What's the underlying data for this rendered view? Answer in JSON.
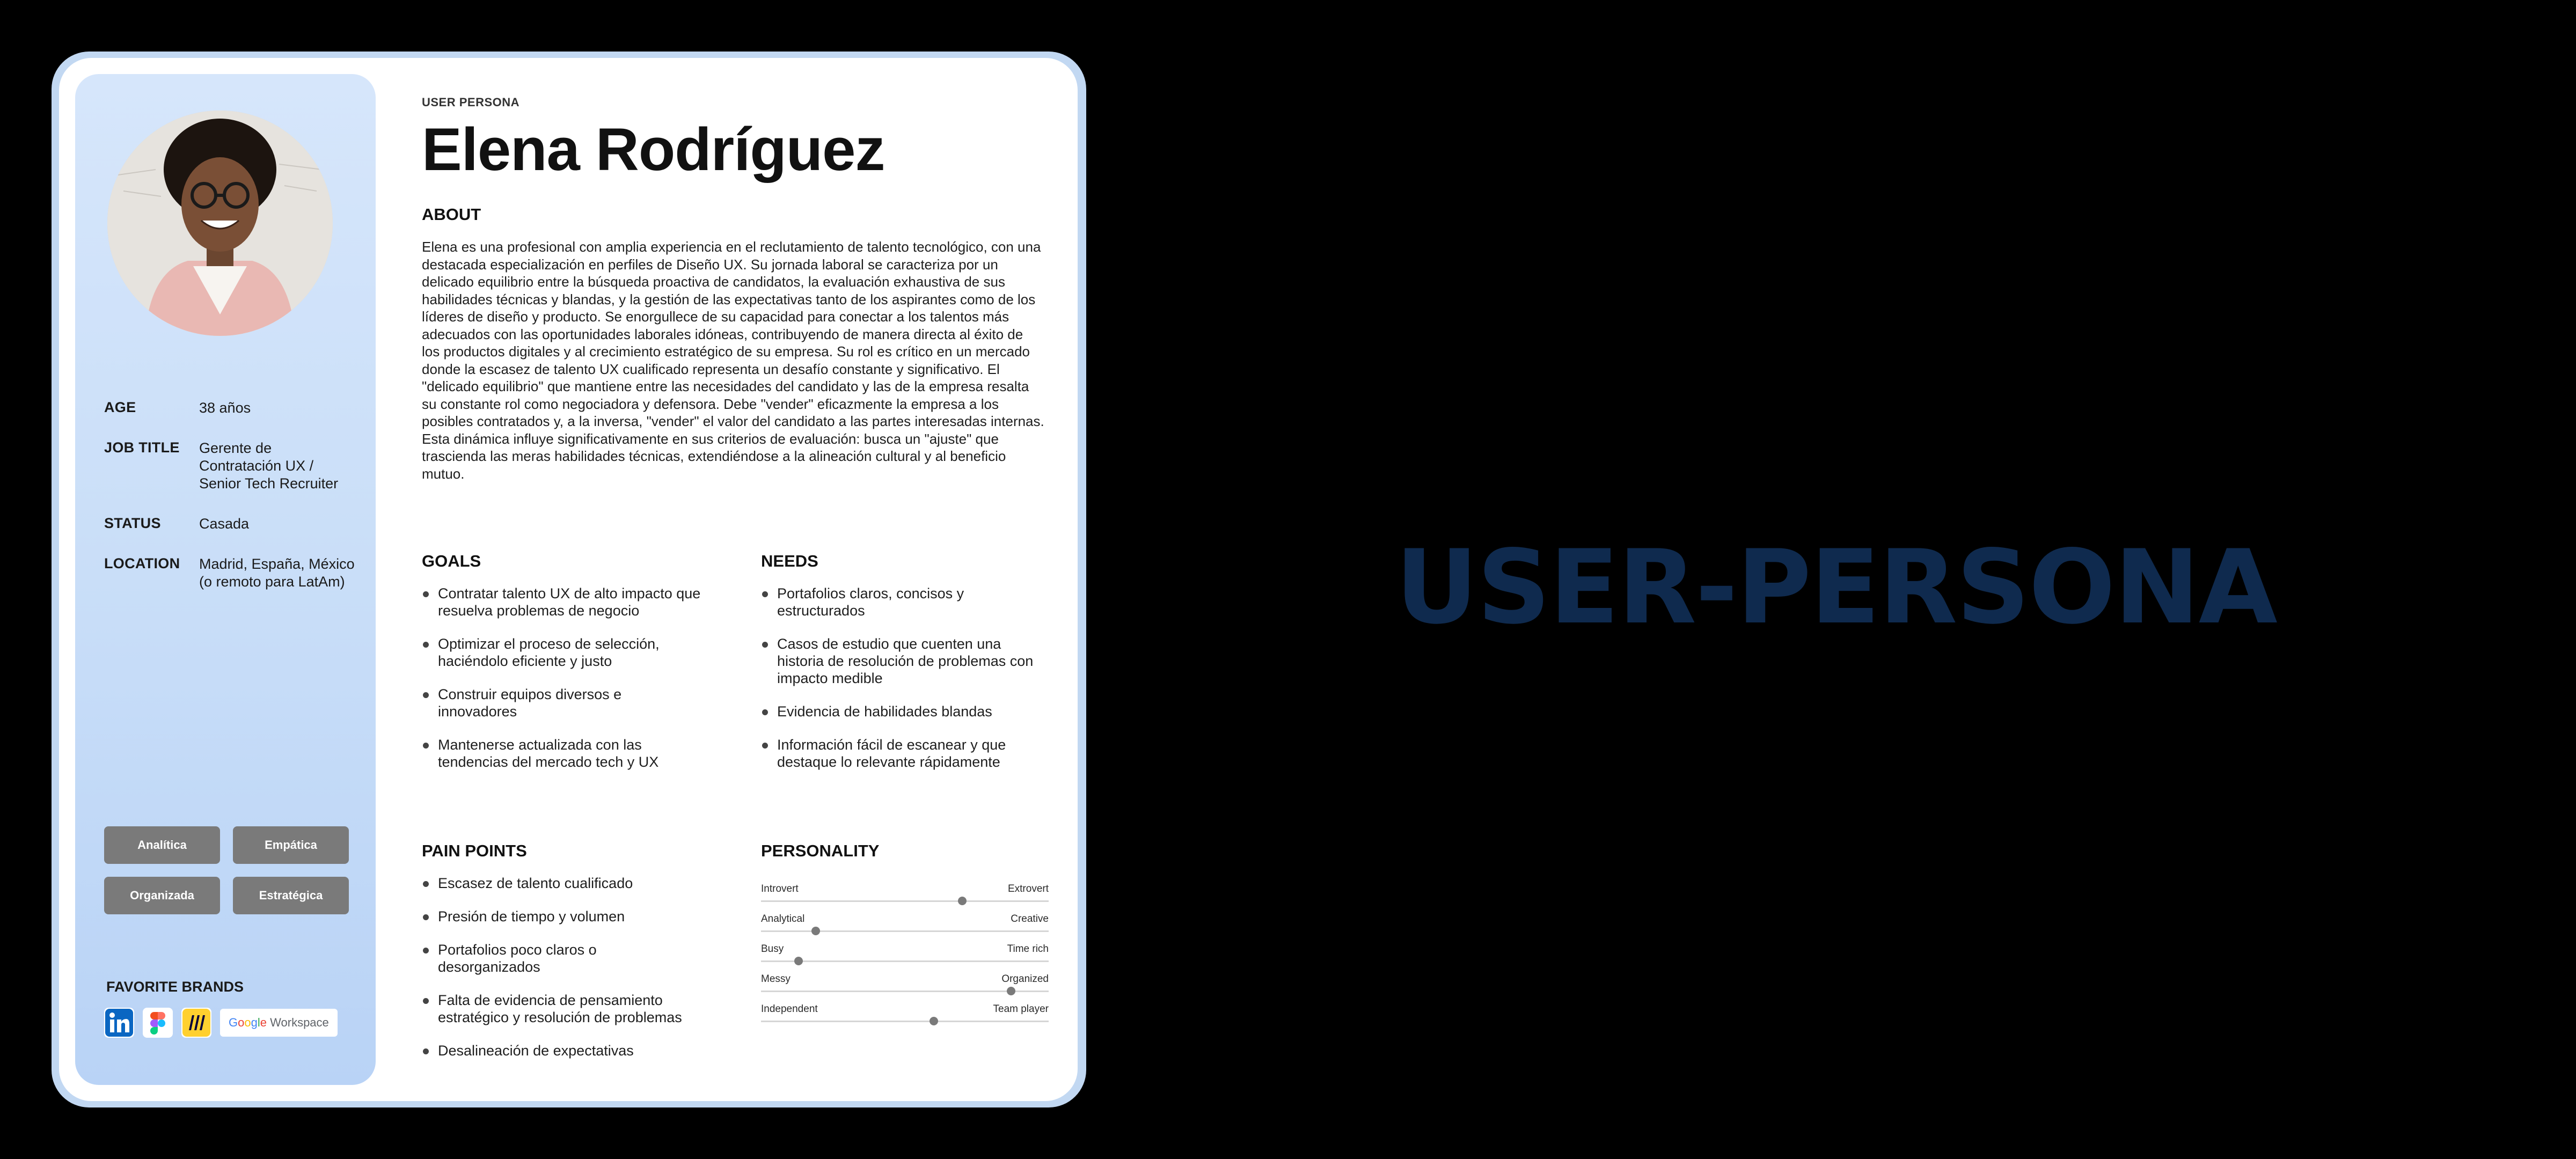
{
  "persona": {
    "eyebrow": "USER PERSONA",
    "name": "Elena Rodríguez",
    "about_title": "ABOUT",
    "about_text": "Elena es una profesional con amplia experiencia en el reclutamiento de talento tecnológico, con una destacada especialización en perfiles de Diseño UX. Su jornada laboral se caracteriza por un delicado equilibrio entre la búsqueda proactiva de candidatos, la evaluación exhaustiva de sus habilidades técnicas y blandas, y la gestión de las expectativas tanto de los aspirantes como de los líderes de diseño y producto. Se enorgullece de su capacidad para conectar a los talentos más adecuados con las oportunidades laborales idóneas, contribuyendo de manera directa al éxito de los productos digitales y al crecimiento estratégico de su empresa. Su rol es crítico en un mercado donde la escasez de talento UX cualificado representa un desafío constante y significativo. El \"delicado equilibrio\" que mantiene entre las necesidades del candidato y las de la empresa resalta su constante rol como negociadora y defensora. Debe \"vender\" eficazmente la empresa a los posibles contratados y, a la inversa, \"vender\" el valor del candidato a las partes interesadas internas. Esta dinámica influye significativamente en sus criterios de evaluación: busca un \"ajuste\" que trascienda las meras habilidades técnicas, extendiéndose a la alineación cultural y al beneficio mutuo."
  },
  "sidebar": {
    "info": [
      {
        "key": "AGE",
        "value": "38 años"
      },
      {
        "key": "JOB TITLE",
        "value": "Gerente de Contratación UX / Senior Tech Recruiter"
      },
      {
        "key": "STATUS",
        "value": "Casada"
      },
      {
        "key": "LOCATION",
        "value": "Madrid, España, México (o remoto para LatAm)"
      }
    ],
    "traits": [
      "Analítica",
      "Empática",
      "Organizada",
      "Estratégica"
    ],
    "brands_title": "FAVORITE BRANDS",
    "brands": [
      "linkedin-icon",
      "figma-icon",
      "miro-icon",
      "google-workspace-logo"
    ],
    "google_workspace_word": "Workspace"
  },
  "goals": {
    "title": "GOALS",
    "items": [
      "Contratar talento UX de alto impacto que resuelva problemas de negocio",
      "Optimizar el proceso de selección, haciéndolo eficiente y justo",
      "Construir equipos diversos e innovadores",
      "Mantenerse actualizada con las tendencias del mercado tech y UX"
    ]
  },
  "needs": {
    "title": "NEEDS",
    "items": [
      "Portafolios claros, concisos y estructurados",
      "Casos de estudio que cuenten una historia de resolución de problemas con impacto medible",
      "Evidencia de habilidades blandas",
      "Información fácil de escanear y que destaque lo relevante rápidamente"
    ]
  },
  "pain_points": {
    "title": "PAIN POINTS",
    "items": [
      "Escasez de talento cualificado",
      "Presión de tiempo y volumen",
      "Portafolios poco claros o desorganizados",
      "Falta de evidencia de pensamiento estratégico y resolución de problemas",
      "Desalineación de expectativas"
    ]
  },
  "personality": {
    "title": "PERSONALITY",
    "scales": [
      {
        "left": "Introvert",
        "right": "Extrovert",
        "level": 0.7
      },
      {
        "left": "Analytical",
        "right": "Creative",
        "level": 0.19
      },
      {
        "left": "Busy",
        "right": "Time rich",
        "level": 0.13
      },
      {
        "left": "Messy",
        "right": "Organized",
        "level": 0.87
      },
      {
        "left": "Independent",
        "right": "Team player",
        "level": 0.6
      }
    ]
  },
  "headline": "USER-PERSONA",
  "colors": {
    "sidebar_gradient_top": "#d6e6fb",
    "sidebar_gradient_bottom": "#b9d3f6",
    "trait_chip": "#7a7a7a",
    "headline": "#0f2a4e",
    "frame": "#c2d8f2"
  }
}
